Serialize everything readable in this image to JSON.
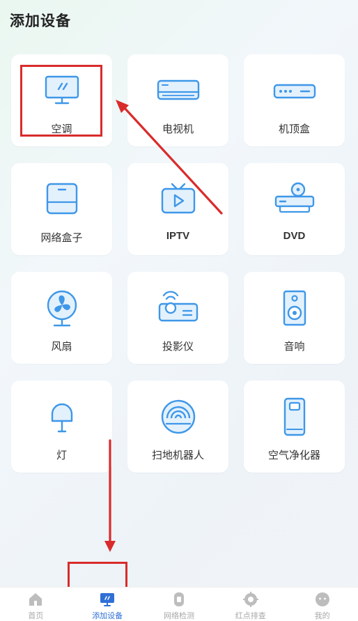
{
  "header": {
    "title": "添加设备"
  },
  "devices": [
    {
      "id": "ac",
      "label": "空调",
      "icon": "air-conditioner-icon"
    },
    {
      "id": "tv",
      "label": "电视机",
      "icon": "tv-wall-unit-icon"
    },
    {
      "id": "stb",
      "label": "机顶盒",
      "icon": "set-top-box-icon"
    },
    {
      "id": "netbox",
      "label": "网络盒子",
      "icon": "network-box-icon"
    },
    {
      "id": "iptv",
      "label": "IPTV",
      "icon": "iptv-icon"
    },
    {
      "id": "dvd",
      "label": "DVD",
      "icon": "dvd-player-icon"
    },
    {
      "id": "fan",
      "label": "风扇",
      "icon": "fan-icon"
    },
    {
      "id": "projector",
      "label": "投影仪",
      "icon": "projector-icon"
    },
    {
      "id": "speaker",
      "label": "音响",
      "icon": "speaker-icon"
    },
    {
      "id": "light",
      "label": "灯",
      "icon": "lamp-icon"
    },
    {
      "id": "robot",
      "label": "扫地机器人",
      "icon": "robot-vacuum-icon"
    },
    {
      "id": "purifier",
      "label": "空气净化器",
      "icon": "air-purifier-icon"
    }
  ],
  "tabbar": {
    "items": [
      {
        "label": "首页",
        "icon": "home-icon",
        "active": false
      },
      {
        "label": "添加设备",
        "icon": "add-device-icon",
        "active": true
      },
      {
        "label": "网络检测",
        "icon": "network-check-icon",
        "active": false
      },
      {
        "label": "红点排查",
        "icon": "red-dot-check-icon",
        "active": false
      },
      {
        "label": "我的",
        "icon": "profile-icon",
        "active": false
      }
    ]
  },
  "colors": {
    "icon_blue": "#3e97e8",
    "icon_fill_light": "#e3f1fd",
    "active_tab": "#2f6fd6",
    "annotation_red": "#d92b2b"
  }
}
